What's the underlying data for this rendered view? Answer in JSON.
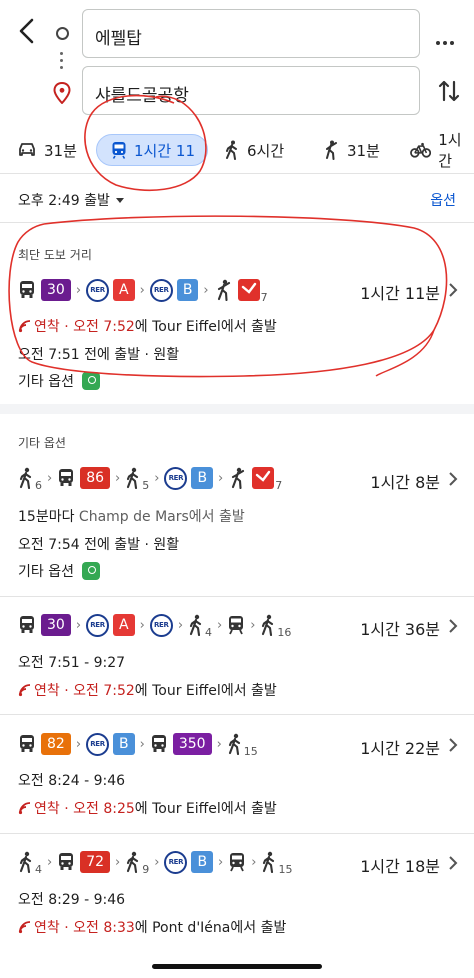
{
  "search": {
    "origin": "에펠탑",
    "destination": "샤를드골공항"
  },
  "tabs": [
    {
      "icon": "car-icon",
      "label": "31분",
      "active": false
    },
    {
      "icon": "train-icon",
      "label": "1시간 11",
      "active": true
    },
    {
      "icon": "walk-icon",
      "label": "6시간",
      "active": false
    },
    {
      "icon": "rideshare-icon",
      "label": "31분",
      "active": false
    },
    {
      "icon": "bike-icon",
      "label": "1시간",
      "active": false
    }
  ],
  "depart": {
    "label": "오후 2:49 출발",
    "options_label": "옵션"
  },
  "section_fastest": "최단 도보 거리",
  "section_other": "기타 옵션",
  "routes": [
    {
      "duration": "1시간 11분",
      "line1": "오전 7:52",
      "line1_prefix": "연착",
      "line1_suffix": "에 Tour Eiffel에서 출발",
      "line2": "오전 7:51 전에 출발 · 원활",
      "other": "기타 옵션",
      "steps": [
        "bus",
        "30",
        "RER",
        "A",
        "RER",
        "B",
        "walk",
        "7"
      ]
    },
    {
      "duration": "1시간 8분",
      "line1_text": "15분마다",
      "line1_place": "Champ de Mars에서 출발",
      "line2": "오전 7:54 전에 출발 · 원활",
      "other": "기타 옵션",
      "steps": [
        "6",
        "86",
        "5",
        "RER",
        "B",
        "7"
      ]
    },
    {
      "duration": "1시간 36분",
      "line1": "오전 7:51 - 9:27",
      "line2_prefix": "연착",
      "line2_time": "오전 7:52",
      "line2_suffix": "에 Tour Eiffel에서 출발",
      "steps": [
        "30",
        "RER",
        "A",
        "RER",
        "4",
        "16"
      ]
    },
    {
      "duration": "1시간 22분",
      "line1": "오전 8:24 - 9:46",
      "line2_prefix": "연착",
      "line2_time": "오전 8:25",
      "line2_suffix": "에 Tour Eiffel에서 출발",
      "steps": [
        "82",
        "RER",
        "B",
        "350",
        "15"
      ]
    },
    {
      "duration": "1시간 18분",
      "line1": "오전 8:29 - 9:46",
      "line2_prefix": "연착",
      "line2_time": "오전 8:33",
      "line2_suffix": "에 Pont d'Iéna에서 출발",
      "steps": [
        "4",
        "72",
        "9",
        "RER",
        "B",
        "15"
      ]
    }
  ],
  "badges": {
    "b30": "30",
    "b86": "86",
    "b82": "82",
    "b72": "72",
    "b350": "350",
    "A": "A",
    "B": "B",
    "RER": "RER",
    "w4": "4",
    "w5": "5",
    "w6": "6",
    "w7": "7",
    "w9": "9",
    "w15": "15",
    "w16": "16"
  },
  "colors": {
    "accent": "#0b57d0",
    "bus30": "#6b1c8f",
    "bus86": "#d93025",
    "bus82": "#e8710a",
    "bus72": "#d93025",
    "bus350": "#7b1fa2",
    "rerA": "#e53935",
    "rerB": "#4a90d9",
    "delay": "#c5221f",
    "annotation": "#e0312b"
  }
}
